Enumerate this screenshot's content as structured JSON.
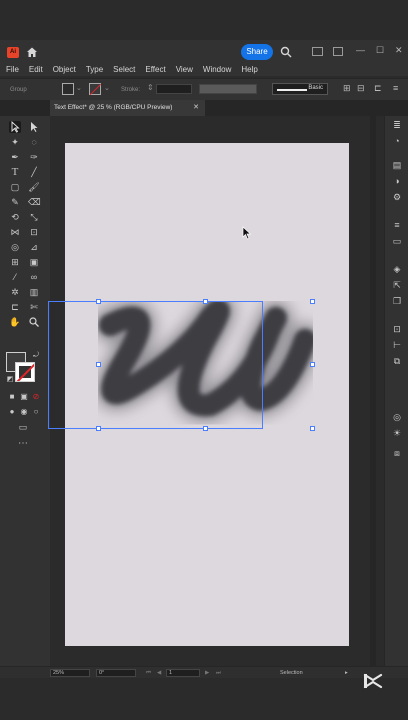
{
  "app": {
    "logo": "Ai",
    "share_label": "Share",
    "window_controls": [
      "—",
      "☐",
      "✕"
    ]
  },
  "menu": [
    "File",
    "Edit",
    "Object",
    "Type",
    "Select",
    "Effect",
    "View",
    "Window",
    "Help"
  ],
  "control_bar": {
    "selection_label": "Group",
    "stroke_label": "Stroke:",
    "brush_definition": "Basic"
  },
  "document_tab": {
    "title": "Text Effect* @ 25 % (RGB/CPU Preview)",
    "close": "✕"
  },
  "status_bar": {
    "zoom": "25%",
    "rotation": "0°",
    "artboard_number": "1",
    "current_tool": "Selection"
  },
  "colors": {
    "accent": "#1473e6",
    "selection": "#4a7dff",
    "artboard": "#ddd8dd",
    "logo": "#e8442a"
  },
  "icons": [
    "home-icon",
    "search-icon",
    "selection-tool-icon",
    "direct-selection-icon",
    "pen-tool-icon",
    "type-tool-icon",
    "rectangle-tool-icon",
    "brush-tool-icon",
    "hand-tool-icon",
    "zoom-tool-icon",
    "layers-icon",
    "properties-icon",
    "arrow-cursor-icon"
  ]
}
